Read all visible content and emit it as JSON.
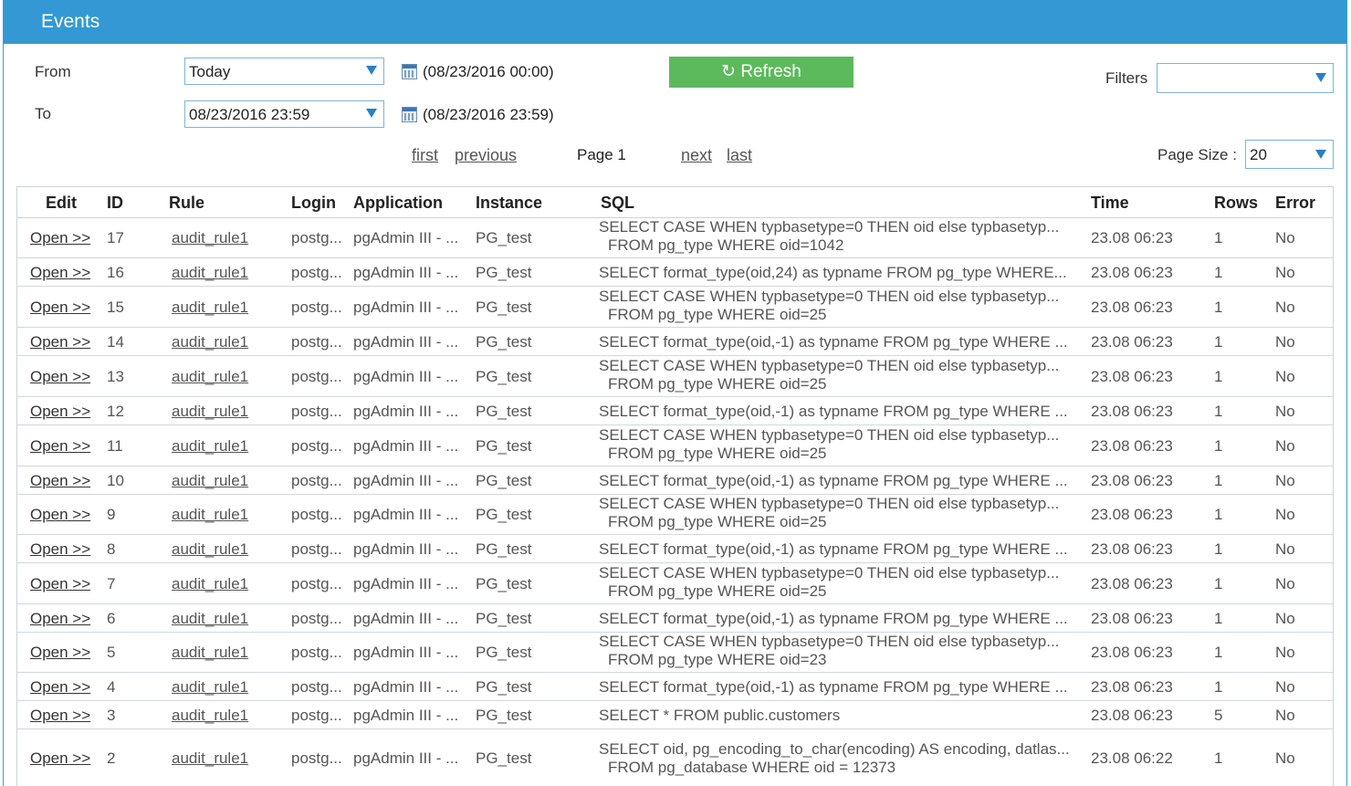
{
  "header": {
    "title": "Events"
  },
  "from": {
    "label": "From",
    "select_value": "Today",
    "cal_text": "(08/23/2016 00:00)"
  },
  "to": {
    "label": "To",
    "select_value": "08/23/2016 23:59",
    "cal_text": "(08/23/2016 23:59)"
  },
  "refresh": {
    "label": "↻ Refresh"
  },
  "filters": {
    "label": "Filters",
    "value": ""
  },
  "pager": {
    "first": "first",
    "previous": "previous",
    "page": "Page 1",
    "next": "next",
    "last": "last"
  },
  "page_size": {
    "label": "Page Size :",
    "value": "20"
  },
  "columns": [
    "Edit",
    "ID",
    "Rule",
    "Login",
    "Application",
    "Instance",
    "SQL",
    "Time",
    "Rows",
    "Error"
  ],
  "rows": [
    {
      "edit": "Open >>",
      "id": "17",
      "rule": "audit_rule1",
      "login": "postg...",
      "app": "pgAdmin III - ...",
      "instance": "PG_test",
      "sql1": "SELECT CASE WHEN typbasetype=0 THEN oid else typbasetyp...",
      "sql2": "FROM pg_type WHERE oid=1042",
      "time": "23.08 06:23",
      "rows": "1",
      "error": "No"
    },
    {
      "edit": "Open >>",
      "id": "16",
      "rule": "audit_rule1",
      "login": "postg...",
      "app": "pgAdmin III - ...",
      "instance": "PG_test",
      "sql1": "SELECT format_type(oid,24) as typname FROM pg_type WHERE...",
      "sql2": "",
      "time": "23.08 06:23",
      "rows": "1",
      "error": "No"
    },
    {
      "edit": "Open >>",
      "id": "15",
      "rule": "audit_rule1",
      "login": "postg...",
      "app": "pgAdmin III - ...",
      "instance": "PG_test",
      "sql1": "SELECT CASE WHEN typbasetype=0 THEN oid else typbasetyp...",
      "sql2": "FROM pg_type WHERE oid=25",
      "time": "23.08 06:23",
      "rows": "1",
      "error": "No"
    },
    {
      "edit": "Open >>",
      "id": "14",
      "rule": "audit_rule1",
      "login": "postg...",
      "app": "pgAdmin III - ...",
      "instance": "PG_test",
      "sql1": "SELECT format_type(oid,-1) as typname FROM pg_type WHERE ...",
      "sql2": "",
      "time": "23.08 06:23",
      "rows": "1",
      "error": "No"
    },
    {
      "edit": "Open >>",
      "id": "13",
      "rule": "audit_rule1",
      "login": "postg...",
      "app": "pgAdmin III - ...",
      "instance": "PG_test",
      "sql1": "SELECT CASE WHEN typbasetype=0 THEN oid else typbasetyp...",
      "sql2": "FROM pg_type WHERE oid=25",
      "time": "23.08 06:23",
      "rows": "1",
      "error": "No"
    },
    {
      "edit": "Open >>",
      "id": "12",
      "rule": "audit_rule1",
      "login": "postg...",
      "app": "pgAdmin III - ...",
      "instance": "PG_test",
      "sql1": "SELECT format_type(oid,-1) as typname FROM pg_type WHERE ...",
      "sql2": "",
      "time": "23.08 06:23",
      "rows": "1",
      "error": "No"
    },
    {
      "edit": "Open >>",
      "id": "11",
      "rule": "audit_rule1",
      "login": "postg...",
      "app": "pgAdmin III - ...",
      "instance": "PG_test",
      "sql1": "SELECT CASE WHEN typbasetype=0 THEN oid else typbasetyp...",
      "sql2": "FROM pg_type WHERE oid=25",
      "time": "23.08 06:23",
      "rows": "1",
      "error": "No"
    },
    {
      "edit": "Open >>",
      "id": "10",
      "rule": "audit_rule1",
      "login": "postg...",
      "app": "pgAdmin III - ...",
      "instance": "PG_test",
      "sql1": "SELECT format_type(oid,-1) as typname FROM pg_type WHERE ...",
      "sql2": "",
      "time": "23.08 06:23",
      "rows": "1",
      "error": "No"
    },
    {
      "edit": "Open >>",
      "id": "9",
      "rule": "audit_rule1",
      "login": "postg...",
      "app": "pgAdmin III - ...",
      "instance": "PG_test",
      "sql1": "SELECT CASE WHEN typbasetype=0 THEN oid else typbasetyp...",
      "sql2": "FROM pg_type WHERE oid=25",
      "time": "23.08 06:23",
      "rows": "1",
      "error": "No"
    },
    {
      "edit": "Open >>",
      "id": "8",
      "rule": "audit_rule1",
      "login": "postg...",
      "app": "pgAdmin III - ...",
      "instance": "PG_test",
      "sql1": "SELECT format_type(oid,-1) as typname FROM pg_type WHERE ...",
      "sql2": "",
      "time": "23.08 06:23",
      "rows": "1",
      "error": "No"
    },
    {
      "edit": "Open >>",
      "id": "7",
      "rule": "audit_rule1",
      "login": "postg...",
      "app": "pgAdmin III - ...",
      "instance": "PG_test",
      "sql1": "SELECT CASE WHEN typbasetype=0 THEN oid else typbasetyp...",
      "sql2": "FROM pg_type WHERE oid=25",
      "time": "23.08 06:23",
      "rows": "1",
      "error": "No"
    },
    {
      "edit": "Open >>",
      "id": "6",
      "rule": "audit_rule1",
      "login": "postg...",
      "app": "pgAdmin III - ...",
      "instance": "PG_test",
      "sql1": "SELECT format_type(oid,-1) as typname FROM pg_type WHERE ...",
      "sql2": "",
      "time": "23.08 06:23",
      "rows": "1",
      "error": "No"
    },
    {
      "edit": "Open >>",
      "id": "5",
      "rule": "audit_rule1",
      "login": "postg...",
      "app": "pgAdmin III - ...",
      "instance": "PG_test",
      "sql1": "SELECT CASE WHEN typbasetype=0 THEN oid else typbasetyp...",
      "sql2": "FROM pg_type WHERE oid=23",
      "time": "23.08 06:23",
      "rows": "1",
      "error": "No"
    },
    {
      "edit": "Open >>",
      "id": "4",
      "rule": "audit_rule1",
      "login": "postg...",
      "app": "pgAdmin III - ...",
      "instance": "PG_test",
      "sql1": "SELECT format_type(oid,-1) as typname FROM pg_type WHERE ...",
      "sql2": "",
      "time": "23.08 06:23",
      "rows": "1",
      "error": "No"
    },
    {
      "edit": "Open >>",
      "id": "3",
      "rule": "audit_rule1",
      "login": "postg...",
      "app": "pgAdmin III - ...",
      "instance": "PG_test",
      "sql1": "SELECT * FROM public.customers",
      "sql2": "",
      "time": "23.08 06:23",
      "rows": "5",
      "error": "No"
    },
    {
      "edit": "Open >>",
      "id": "2",
      "rule": "audit_rule1",
      "login": "postg...",
      "app": "pgAdmin III - ...",
      "instance": "PG_test",
      "sql1": "SELECT oid, pg_encoding_to_char(encoding) AS encoding, datlas...",
      "sql2": "FROM pg_database WHERE oid = 12373",
      "time": "23.08 06:22",
      "rows": "1",
      "error": "No"
    }
  ]
}
